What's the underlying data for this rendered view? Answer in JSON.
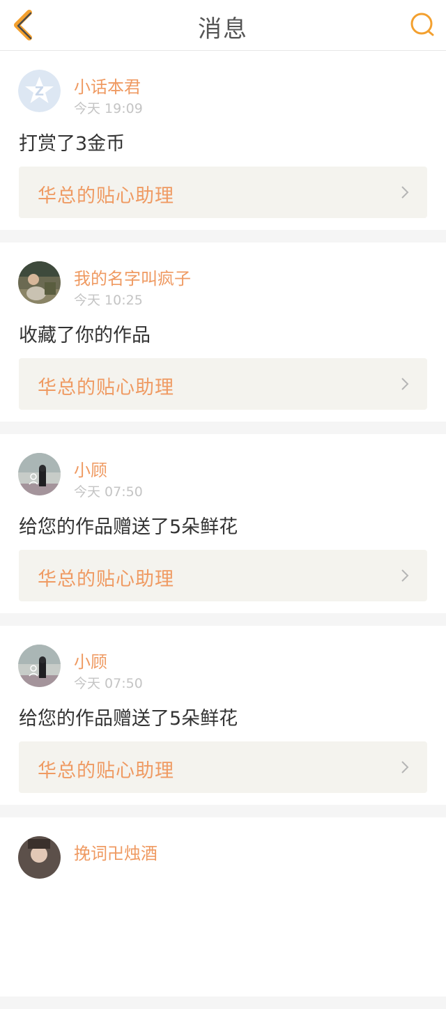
{
  "header": {
    "title": "消息",
    "back_icon": "chevron-left-icon",
    "search_icon": "search-icon",
    "accent_color": "#f3a02f"
  },
  "notifications": [
    {
      "username": "小话本君",
      "time": "今天 19:09",
      "message": "打赏了3金币",
      "work_title": "华总的贴心助理",
      "avatar": "default-avatar-icon"
    },
    {
      "username": "我的名字叫疯子",
      "time": "今天 10:25",
      "message": "收藏了你的作品",
      "work_title": "华总的贴心助理",
      "avatar": "user-photo"
    },
    {
      "username": "小顾",
      "time": "今天 07:50",
      "message": "给您的作品赠送了5朵鲜花",
      "work_title": "华总的贴心助理",
      "avatar": "user-photo"
    },
    {
      "username": "小顾",
      "time": "今天 07:50",
      "message": "给您的作品赠送了5朵鲜花",
      "work_title": "华总的贴心助理",
      "avatar": "user-photo"
    },
    {
      "username": "挽词卍烛酒",
      "time": "",
      "message": "",
      "work_title": "",
      "avatar": "user-photo"
    }
  ],
  "colors": {
    "username": "#ef9a62",
    "link_bg": "#f4f3ee",
    "time": "#c4c4c4",
    "page_bg": "#f5f5f5"
  }
}
